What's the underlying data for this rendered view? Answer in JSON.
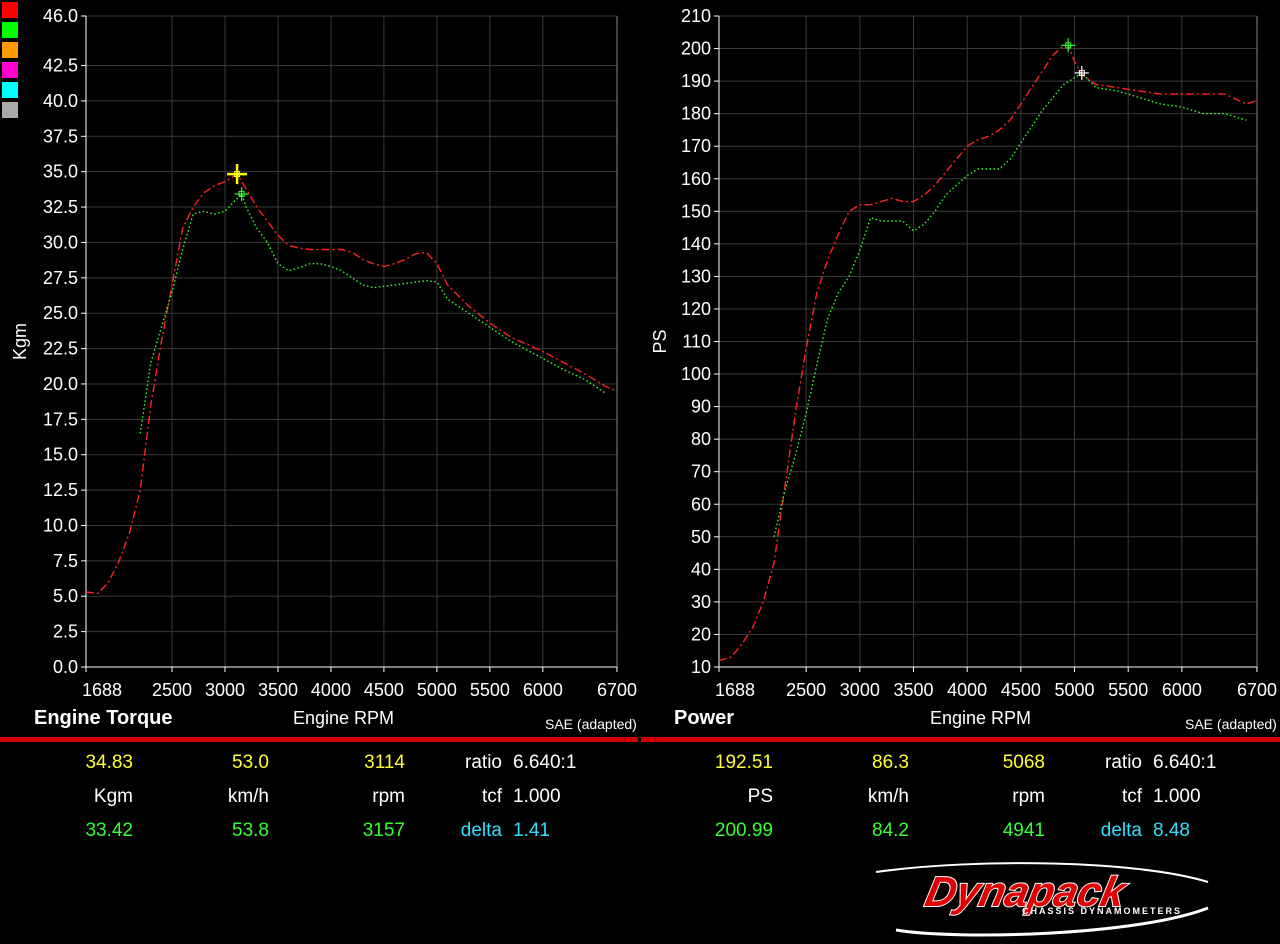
{
  "legend_colors": [
    "#ff0000",
    "#00ff00",
    "#ff9900",
    "#ff00cc",
    "#00ffff",
    "#aaaaaa"
  ],
  "chart_data": [
    {
      "type": "line",
      "title": "Engine Torque",
      "xlabel": "Engine RPM",
      "ylabel": "Kgm",
      "note": "SAE (adapted)",
      "xlim": [
        1688,
        6700
      ],
      "ylim": [
        0,
        46
      ],
      "xticks": [
        "1688",
        "2500",
        "3000",
        "3500",
        "4000",
        "4500",
        "5000",
        "5500",
        "6000",
        "6700"
      ],
      "xtick_values": [
        1688,
        2500,
        3000,
        3500,
        4000,
        4500,
        5000,
        5500,
        6000,
        6700
      ],
      "yticks": [
        "46.0",
        "42.5",
        "40.0",
        "37.5",
        "35.0",
        "32.5",
        "30.0",
        "27.5",
        "25.0",
        "22.5",
        "20.0",
        "17.5",
        "15.0",
        "12.5",
        "10.0",
        "7.5",
        "5.0",
        "2.5",
        "0.0"
      ],
      "ytick_values": [
        46,
        42.5,
        40,
        37.5,
        35,
        32.5,
        30,
        27.5,
        25,
        22.5,
        20,
        17.5,
        15,
        12.5,
        10,
        7.5,
        5,
        2.5,
        0
      ],
      "grid": true,
      "series": [
        {
          "color": "#ff2020",
          "style": "dashdot",
          "x": [
            1688,
            1800,
            1900,
            2000,
            2100,
            2200,
            2300,
            2400,
            2500,
            2600,
            2700,
            2800,
            2900,
            3000,
            3114,
            3200,
            3300,
            3400,
            3500,
            3600,
            3700,
            3800,
            3900,
            4000,
            4100,
            4200,
            4300,
            4400,
            4500,
            4600,
            4700,
            4800,
            4900,
            5000,
            5100,
            5300,
            5500,
            5700,
            6000,
            6200,
            6400,
            6600,
            6700
          ],
          "y": [
            5.3,
            5.2,
            6.0,
            7.5,
            9.5,
            12.5,
            18.5,
            23.0,
            27.0,
            31.0,
            32.5,
            33.5,
            34.0,
            34.3,
            34.83,
            33.8,
            32.5,
            31.5,
            30.5,
            29.8,
            29.6,
            29.5,
            29.5,
            29.5,
            29.5,
            29.3,
            28.8,
            28.5,
            28.3,
            28.5,
            28.8,
            29.2,
            29.3,
            28.5,
            27.0,
            25.5,
            24.3,
            23.3,
            22.3,
            21.5,
            20.7,
            19.8,
            19.5
          ]
        },
        {
          "color": "#33ff33",
          "style": "dotted",
          "x": [
            2200,
            2300,
            2400,
            2500,
            2600,
            2700,
            2800,
            2900,
            3000,
            3100,
            3157,
            3200,
            3300,
            3400,
            3500,
            3600,
            3700,
            3800,
            3900,
            4000,
            4100,
            4200,
            4300,
            4400,
            4500,
            4700,
            4900,
            5000,
            5100,
            5300,
            5500,
            5700,
            6000,
            6200,
            6400,
            6600
          ],
          "y": [
            16.5,
            21.5,
            24.0,
            26.5,
            29.5,
            32.0,
            32.2,
            32.0,
            32.2,
            33.0,
            33.42,
            32.5,
            31.0,
            30.0,
            28.5,
            28.0,
            28.2,
            28.5,
            28.5,
            28.3,
            28.0,
            27.5,
            27.0,
            26.8,
            26.9,
            27.1,
            27.3,
            27.2,
            26.0,
            25.0,
            24.0,
            23.0,
            21.8,
            21.0,
            20.3,
            19.3
          ]
        }
      ],
      "cursors": [
        {
          "x": 3114,
          "y": 34.83,
          "color": "#ffff00"
        },
        {
          "x": 3157,
          "y": 33.42,
          "color": "#33ff33"
        }
      ]
    },
    {
      "type": "line",
      "title": "Power",
      "xlabel": "Engine RPM",
      "ylabel": "PS",
      "note": "SAE (adapted)",
      "xlim": [
        1688,
        6700
      ],
      "ylim": [
        10,
        210
      ],
      "xticks": [
        "1688",
        "2500",
        "3000",
        "3500",
        "4000",
        "4500",
        "5000",
        "5500",
        "6000",
        "6700"
      ],
      "xtick_values": [
        1688,
        2500,
        3000,
        3500,
        4000,
        4500,
        5000,
        5500,
        6000,
        6700
      ],
      "yticks": [
        "210",
        "200",
        "190",
        "180",
        "170",
        "160",
        "150",
        "140",
        "130",
        "120",
        "110",
        "100",
        "90",
        "80",
        "70",
        "60",
        "50",
        "40",
        "30",
        "20",
        "10"
      ],
      "ytick_values": [
        210,
        200,
        190,
        180,
        170,
        160,
        150,
        140,
        130,
        120,
        110,
        100,
        90,
        80,
        70,
        60,
        50,
        40,
        30,
        20,
        10
      ],
      "grid": true,
      "series": [
        {
          "color": "#ff2020",
          "style": "dashdot",
          "x": [
            1688,
            1800,
            1900,
            2000,
            2100,
            2200,
            2300,
            2400,
            2500,
            2600,
            2700,
            2800,
            2900,
            3000,
            3100,
            3200,
            3300,
            3400,
            3500,
            3600,
            3700,
            3800,
            3900,
            4000,
            4100,
            4200,
            4300,
            4400,
            4500,
            4600,
            4700,
            4800,
            4900,
            4941,
            5000,
            5068,
            5200,
            5400,
            5600,
            5800,
            6000,
            6200,
            6400,
            6600,
            6700
          ],
          "y": [
            12,
            13,
            17,
            22,
            30,
            42,
            65,
            88,
            108,
            125,
            135,
            143,
            150,
            152,
            152,
            153,
            154,
            153,
            153,
            155,
            158,
            162,
            166,
            170,
            172,
            173,
            175,
            178,
            183,
            188,
            193,
            198,
            201,
            200.99,
            196,
            192,
            189,
            188,
            187,
            186,
            186,
            186,
            186,
            183,
            184
          ]
        },
        {
          "color": "#33ff33",
          "style": "dotted",
          "x": [
            2200,
            2300,
            2400,
            2500,
            2600,
            2700,
            2800,
            2900,
            3000,
            3100,
            3200,
            3300,
            3400,
            3500,
            3600,
            3700,
            3800,
            3900,
            4000,
            4100,
            4200,
            4300,
            4400,
            4500,
            4600,
            4700,
            4800,
            4900,
            5000,
            5068,
            5200,
            5400,
            5600,
            5800,
            6000,
            6200,
            6400,
            6600
          ],
          "y": [
            50,
            64,
            75,
            88,
            103,
            117,
            125,
            130,
            138,
            148,
            147,
            147,
            147,
            144,
            146,
            150,
            155,
            158,
            161,
            163,
            163,
            163,
            166,
            171,
            176,
            181,
            185,
            189,
            191,
            192.51,
            188,
            187,
            185,
            183,
            182,
            180,
            180,
            178
          ]
        }
      ],
      "cursors": [
        {
          "x": 4941,
          "y": 200.99,
          "color": "#33ff33"
        },
        {
          "x": 5068,
          "y": 192.51,
          "color": "#ffffff"
        }
      ]
    }
  ],
  "readouts": {
    "torque": {
      "row1": {
        "value": "34.83",
        "speed": "53.0",
        "rpm": "3114",
        "ratio_label": "ratio",
        "ratio_value": "6.640:1"
      },
      "row2": {
        "unit": "Kgm",
        "speed_unit": "km/h",
        "rpm_unit": "rpm",
        "tcf_label": "tcf",
        "tcf_value": "1.000"
      },
      "row3": {
        "value": "33.42",
        "speed": "53.8",
        "rpm": "3157",
        "delta_label": "delta",
        "delta_value": "1.41"
      }
    },
    "power": {
      "row1": {
        "value": "192.51",
        "speed": "86.3",
        "rpm": "5068",
        "ratio_label": "ratio",
        "ratio_value": "6.640:1"
      },
      "row2": {
        "unit": "PS",
        "speed_unit": "km/h",
        "rpm_unit": "rpm",
        "tcf_label": "tcf",
        "tcf_value": "1.000"
      },
      "row3": {
        "value": "200.99",
        "speed": "84.2",
        "rpm": "4941",
        "delta_label": "delta",
        "delta_value": "8.48"
      }
    }
  },
  "logo": {
    "brand": "Dynapack",
    "tagline": "CHASSIS DYNAMOMETERS"
  }
}
